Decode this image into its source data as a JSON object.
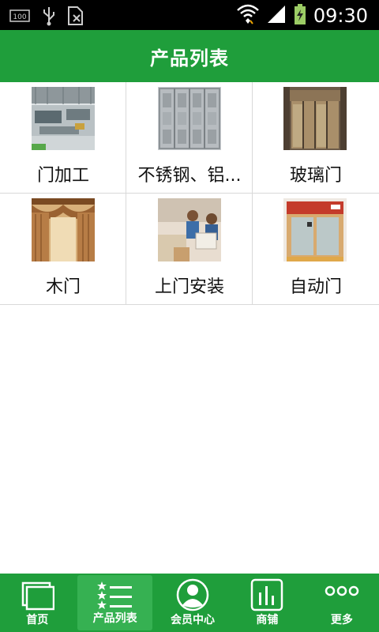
{
  "status_bar": {
    "time": "09:30",
    "icons": [
      "battery-100-icon",
      "usb-icon",
      "sim-icon",
      "wifi-icon",
      "signal-icon",
      "battery-charging-icon"
    ]
  },
  "header": {
    "title": "产品列表"
  },
  "products": [
    {
      "label": "门加工",
      "image": "factory-floor-photo"
    },
    {
      "label": "不锈钢、铝...",
      "image": "steel-door-photo"
    },
    {
      "label": "玻璃门",
      "image": "glass-door-photo"
    },
    {
      "label": "木门",
      "image": "curtain-photo"
    },
    {
      "label": "上门安装",
      "image": "installers-photo"
    },
    {
      "label": "自动门",
      "image": "automatic-door-photo"
    }
  ],
  "bottom_nav": {
    "items": [
      {
        "label": "首页",
        "icon": "home-icon",
        "active": false
      },
      {
        "label": "产品列表",
        "icon": "list-icon",
        "active": true
      },
      {
        "label": "会员中心",
        "icon": "member-icon",
        "active": false
      },
      {
        "label": "商铺",
        "icon": "chart-icon",
        "active": false
      },
      {
        "label": "更多",
        "icon": "more-icon",
        "active": false
      }
    ]
  },
  "colors": {
    "brand_green": "#1f9e3b",
    "active_green": "#36b152"
  }
}
